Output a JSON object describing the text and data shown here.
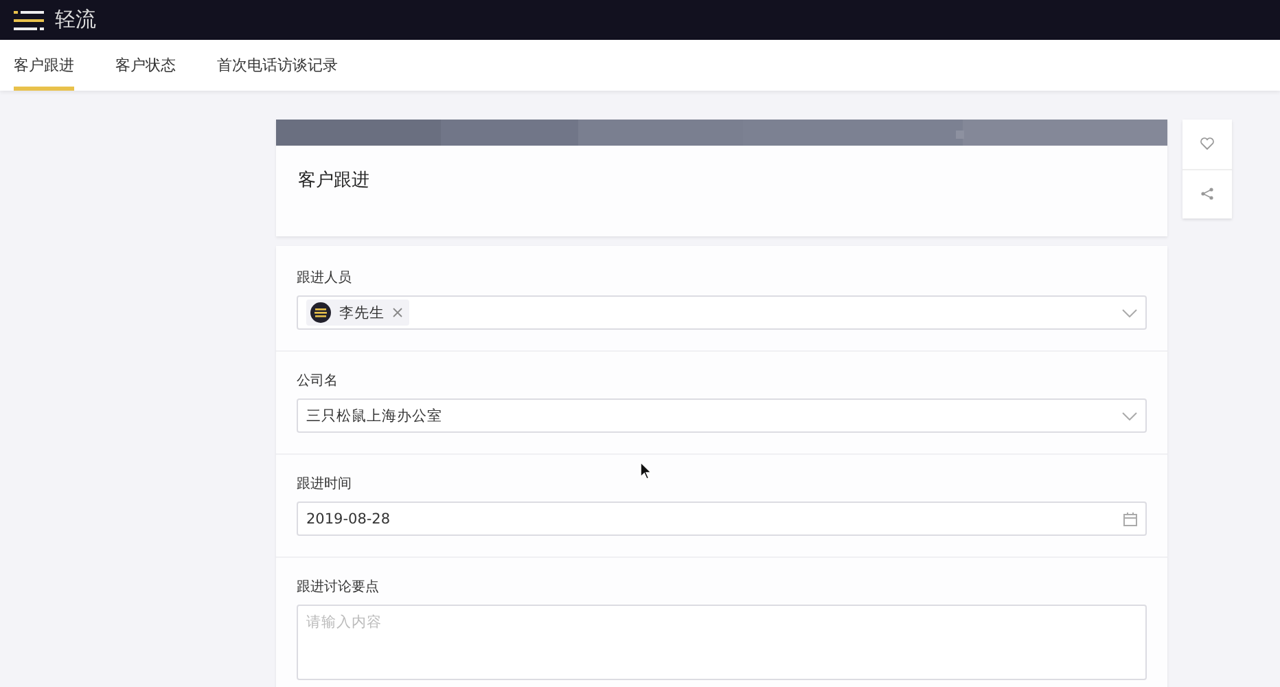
{
  "header": {
    "logo": "轻流"
  },
  "tabs": [
    {
      "label": "客户跟进",
      "selected": true
    },
    {
      "label": "客户状态",
      "selected": false
    },
    {
      "label": "首次电话访谈记录",
      "selected": false
    }
  ],
  "form": {
    "title": "客户跟进",
    "fields": [
      {
        "kind": "members",
        "label": "跟进人员",
        "tags": [
          "李先生"
        ]
      },
      {
        "kind": "select",
        "label": "公司名",
        "value": "三只松鼠上海办公室"
      },
      {
        "kind": "date",
        "label": "跟进时间",
        "value": "2019-08-28"
      },
      {
        "kind": "textarea",
        "label": "跟进讨论要点",
        "placeholder": "请输入内容"
      }
    ]
  }
}
